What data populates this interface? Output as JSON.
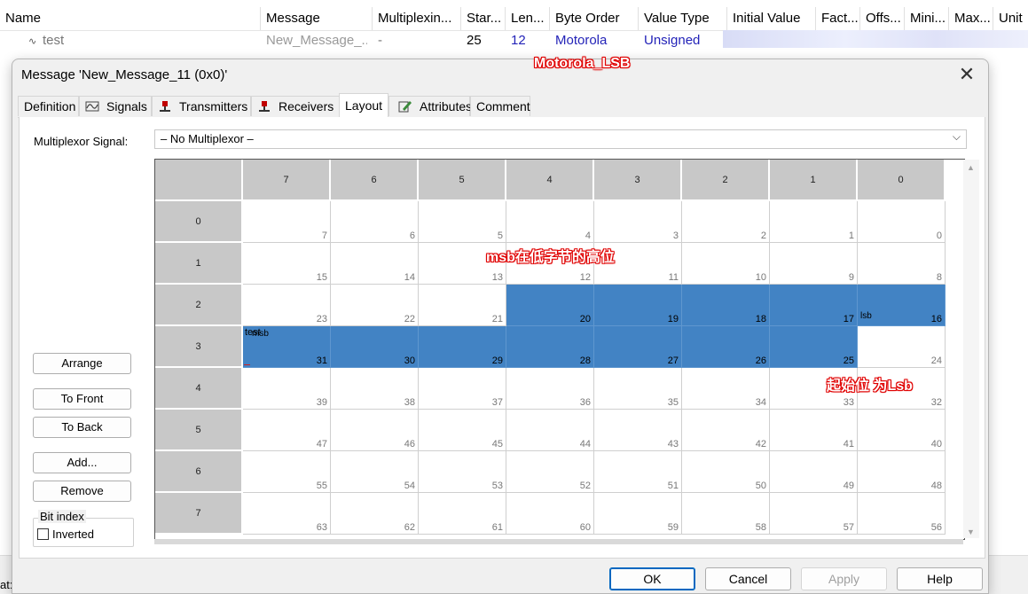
{
  "signal_table": {
    "columns": [
      "Name",
      "Message",
      "Multiplexin...",
      "Star...",
      "Len...",
      "Byte Order",
      "Value Type",
      "Initial Value",
      "Fact...",
      "Offs...",
      "Mini...",
      "Max...",
      "Unit"
    ],
    "row": {
      "name": "test",
      "message": "New_Message_...",
      "multiplexing": "-",
      "start": "25",
      "length": "12",
      "byte_order": "Motorola",
      "value_type": "Unsigned"
    },
    "status_fragment": "at:"
  },
  "annotations": {
    "motorola_lsb": "Motorola_LSB",
    "msb_note": "msb在低字节的高位",
    "start_note": "起始位 为Lsb"
  },
  "dialog": {
    "title": "Message 'New_Message_11 (0x0)'",
    "tabs": [
      {
        "label": "Definition",
        "icon": ""
      },
      {
        "label": "Signals",
        "icon": "signal-wave-icon"
      },
      {
        "label": "Transmitters",
        "icon": "node-pin-icon"
      },
      {
        "label": "Receivers",
        "icon": "node-pin-icon"
      },
      {
        "label": "Layout",
        "icon": ""
      },
      {
        "label": "Attributes",
        "icon": "pencil-icon"
      },
      {
        "label": "Comment",
        "icon": ""
      }
    ],
    "active_tab": "Layout",
    "multiplexor_label": "Multiplexor Signal:",
    "multiplexor_value": "– No Multiplexor –",
    "left_buttons": {
      "arrange": "Arrange",
      "to_front": "To Front",
      "to_back": "To Back",
      "add": "Add...",
      "remove": "Remove"
    },
    "bit_index": {
      "legend": "Bit index",
      "inverted_label": "Inverted",
      "inverted_checked": false
    },
    "footer": {
      "ok": "OK",
      "cancel": "Cancel",
      "apply": "Apply",
      "help": "Help"
    }
  },
  "layout_grid": {
    "column_headers": [
      "7",
      "6",
      "5",
      "4",
      "3",
      "2",
      "1",
      "0"
    ],
    "row_headers": [
      "0",
      "1",
      "2",
      "3",
      "4",
      "5",
      "6",
      "7"
    ],
    "signal": {
      "name": "test",
      "msb_label": "msb",
      "lsb_label": "lsb",
      "bits": [
        16,
        17,
        18,
        19,
        20,
        25,
        26,
        27,
        28,
        29,
        30,
        31
      ]
    },
    "highlight_color": "#4283c4"
  }
}
